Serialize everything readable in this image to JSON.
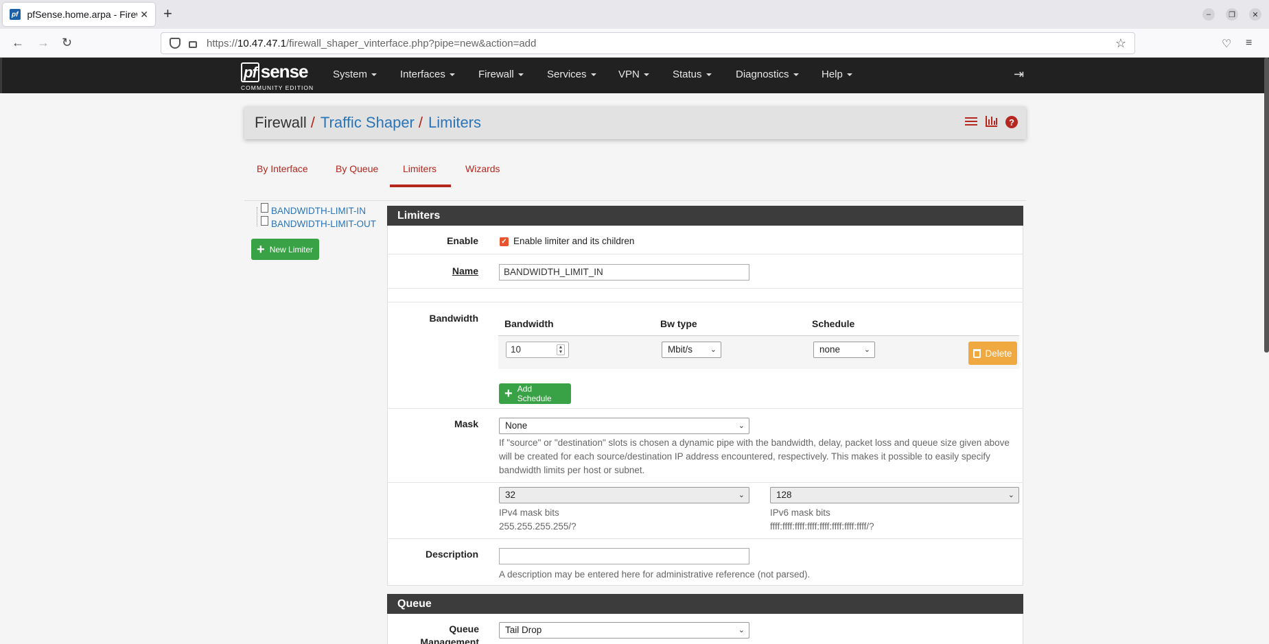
{
  "browser": {
    "tab_title": "pfSense.home.arpa - Firewall: Traffic Shaper: Limiters",
    "url_prefix": "https://",
    "url_host": "10.47.47.1",
    "url_path": "/firewall_shaper_vinterface.php?pipe=new&action=add"
  },
  "logo": {
    "name": "sense",
    "badge": "pf",
    "edition": "COMMUNITY EDITION"
  },
  "menu": [
    "System",
    "Interfaces",
    "Firewall",
    "Services",
    "VPN",
    "Status",
    "Diagnostics",
    "Help"
  ],
  "breadcrumb": [
    "Firewall",
    "Traffic Shaper",
    "Limiters"
  ],
  "tabs": [
    "By Interface",
    "By Queue",
    "Limiters",
    "Wizards"
  ],
  "tree": [
    "BANDWIDTH-LIMIT-IN",
    "BANDWIDTH-LIMIT-OUT"
  ],
  "new_limiter_label": "New Limiter",
  "limiters_section": {
    "title": "Limiters",
    "enable_label": "Enable",
    "enable_text": "Enable limiter and its children",
    "name_label": "Name",
    "name_value": "BANDWIDTH_LIMIT_IN",
    "bandwidth_label": "Bandwidth",
    "bw_headers": [
      "Bandwidth",
      "Bw type",
      "Schedule"
    ],
    "bw_value": "10",
    "bw_type": "Mbit/s",
    "schedule": "none",
    "delete_label": "Delete",
    "add_schedule_label": "Add Schedule",
    "mask_label": "Mask",
    "mask_value": "None",
    "mask_help": "If \"source\" or \"destination\" slots is chosen a dynamic pipe with the bandwidth, delay, packet loss and queue size given above will be created for each source/destination IP address encountered, respectively. This makes it possible to easily specify bandwidth limits per host or subnet.",
    "ipv4_bits": "32",
    "ipv4_label": "IPv4 mask bits",
    "ipv4_mask": "255.255.255.255/?",
    "ipv6_bits": "128",
    "ipv6_label": "IPv6 mask bits",
    "ipv6_mask": "ffff:ffff:ffff:ffff:ffff:ffff:ffff:ffff/?",
    "description_label": "Description",
    "description_value": "",
    "description_help": "A description may be entered here for administrative reference (not parsed)."
  },
  "queue_section": {
    "title": "Queue",
    "qm_label": "Queue Management Algorithm",
    "qm_value": "Tail Drop"
  },
  "colors": {
    "accent": "#b5261e",
    "link": "#2a74b8",
    "nav_bg": "#212121",
    "success": "#3aa246",
    "warning": "#f0a840"
  }
}
